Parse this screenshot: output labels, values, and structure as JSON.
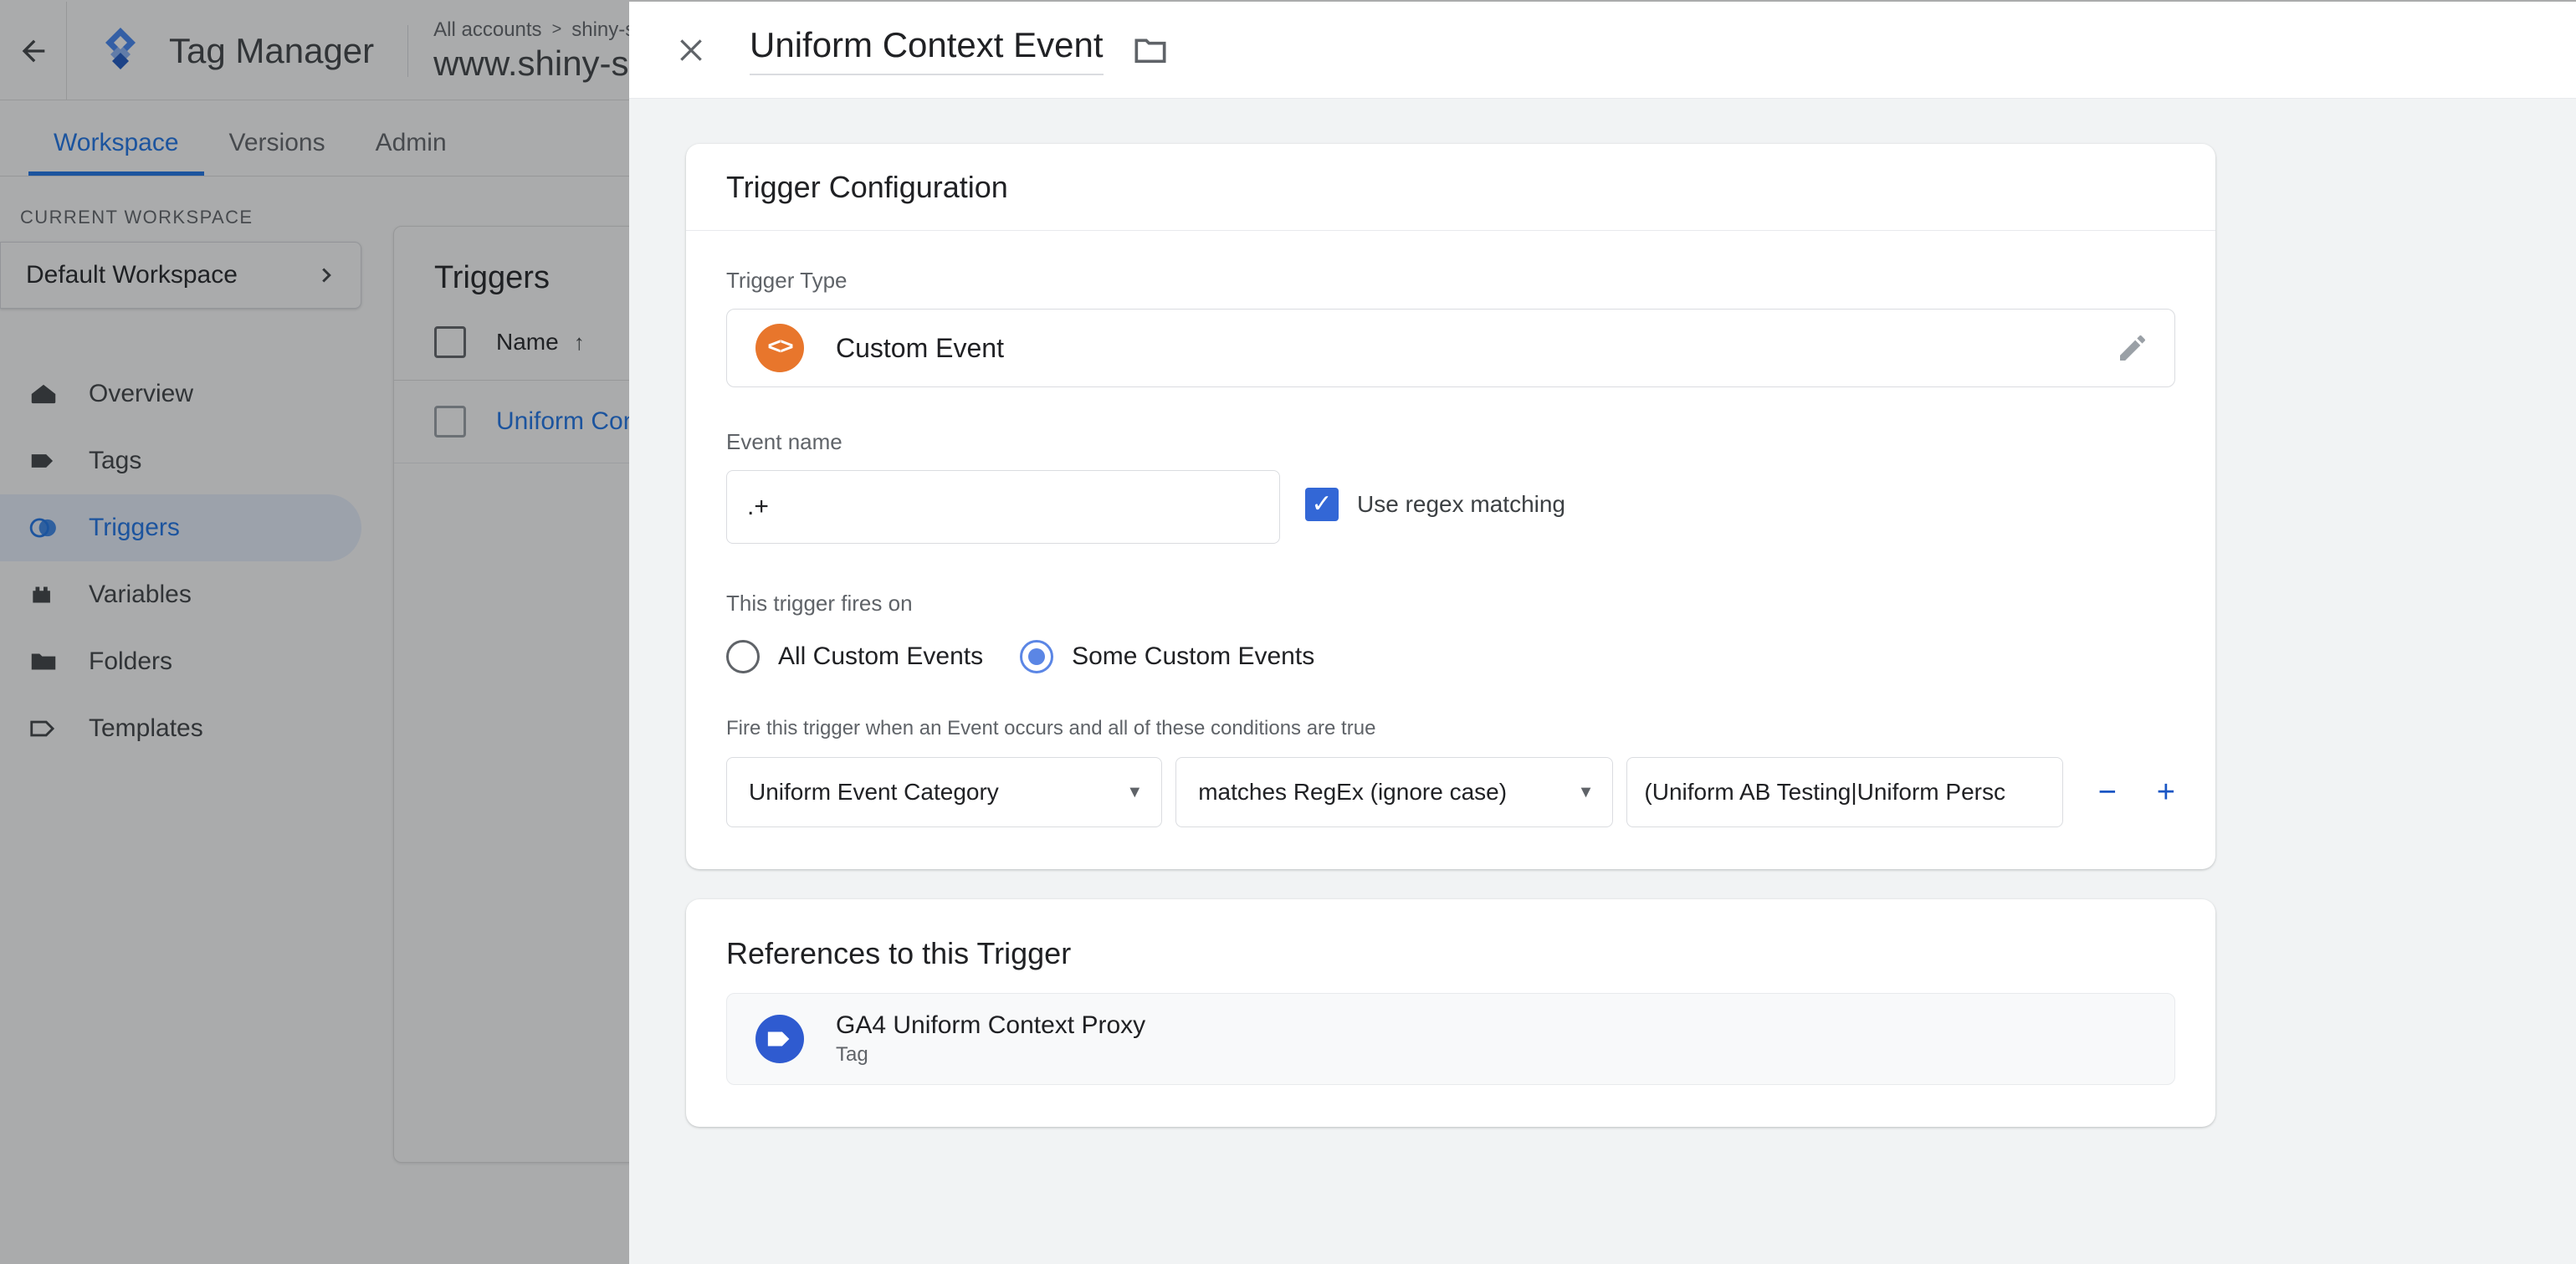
{
  "app": {
    "back_icon": "back-arrow-icon",
    "brand": "Tag Manager",
    "logo_icon": "tag-manager-logo",
    "breadcrumb": {
      "all_accounts": "All accounts",
      "separator": ">",
      "account": "shiny-sa"
    },
    "container_url": "www.shiny-s",
    "tabs": [
      {
        "label": "Workspace",
        "active": true
      },
      {
        "label": "Versions",
        "active": false
      },
      {
        "label": "Admin",
        "active": false
      }
    ],
    "sidebar": {
      "section_label": "CURRENT WORKSPACE",
      "workspace_name": "Default Workspace",
      "workspace_chevron": "chevron-right-icon",
      "items": [
        {
          "label": "Overview",
          "icon": "overview-icon",
          "active": false
        },
        {
          "label": "Tags",
          "icon": "tag-icon",
          "active": false
        },
        {
          "label": "Triggers",
          "icon": "triggers-icon",
          "active": true
        },
        {
          "label": "Variables",
          "icon": "variables-icon",
          "active": false
        },
        {
          "label": "Folders",
          "icon": "folder-icon",
          "active": false
        },
        {
          "label": "Templates",
          "icon": "template-icon",
          "active": false
        }
      ]
    },
    "list_panel": {
      "title": "Triggers",
      "column_name": "Name",
      "sort_arrow": "↑",
      "rows": [
        {
          "name": "Uniform Cont"
        }
      ]
    }
  },
  "modal": {
    "close_icon": "close-icon",
    "title": "Uniform Context Event",
    "folder_icon": "folder-icon",
    "trigger_config": {
      "card_title": "Trigger Configuration",
      "trigger_type_label": "Trigger Type",
      "trigger_type_name": "Custom Event",
      "trigger_type_icon": "code-brackets-icon",
      "edit_icon": "pencil-icon",
      "event_name_label": "Event name",
      "event_name_value": ".+",
      "regex_checkbox_label": "Use regex matching",
      "regex_checkbox_checked": true,
      "regex_check_glyph": "✓",
      "fires_on_label": "This trigger fires on",
      "fires_on_options": [
        {
          "label": "All Custom Events",
          "selected": false
        },
        {
          "label": "Some Custom Events",
          "selected": true
        }
      ],
      "conditions_label": "Fire this trigger when an Event occurs and all of these conditions are true",
      "conditions": [
        {
          "variable": "Uniform Event Category",
          "operator": "matches RegEx (ignore case)",
          "value": "(Uniform AB Testing|Uniform Persc",
          "remove_label": "−",
          "add_label": "+"
        }
      ]
    },
    "references": {
      "card_title": "References to this Trigger",
      "items": [
        {
          "name": "GA4 Uniform Context Proxy",
          "kind": "Tag",
          "icon": "tag-circle-icon"
        }
      ]
    }
  },
  "colors": {
    "accent_blue": "#1a73e8",
    "custom_event_orange": "#e8762c",
    "tag_blue": "#2f5bd0",
    "checkbox_blue": "#3367d6",
    "radio_blue": "#5b86e5",
    "panel_bg": "#f1f3f4"
  }
}
